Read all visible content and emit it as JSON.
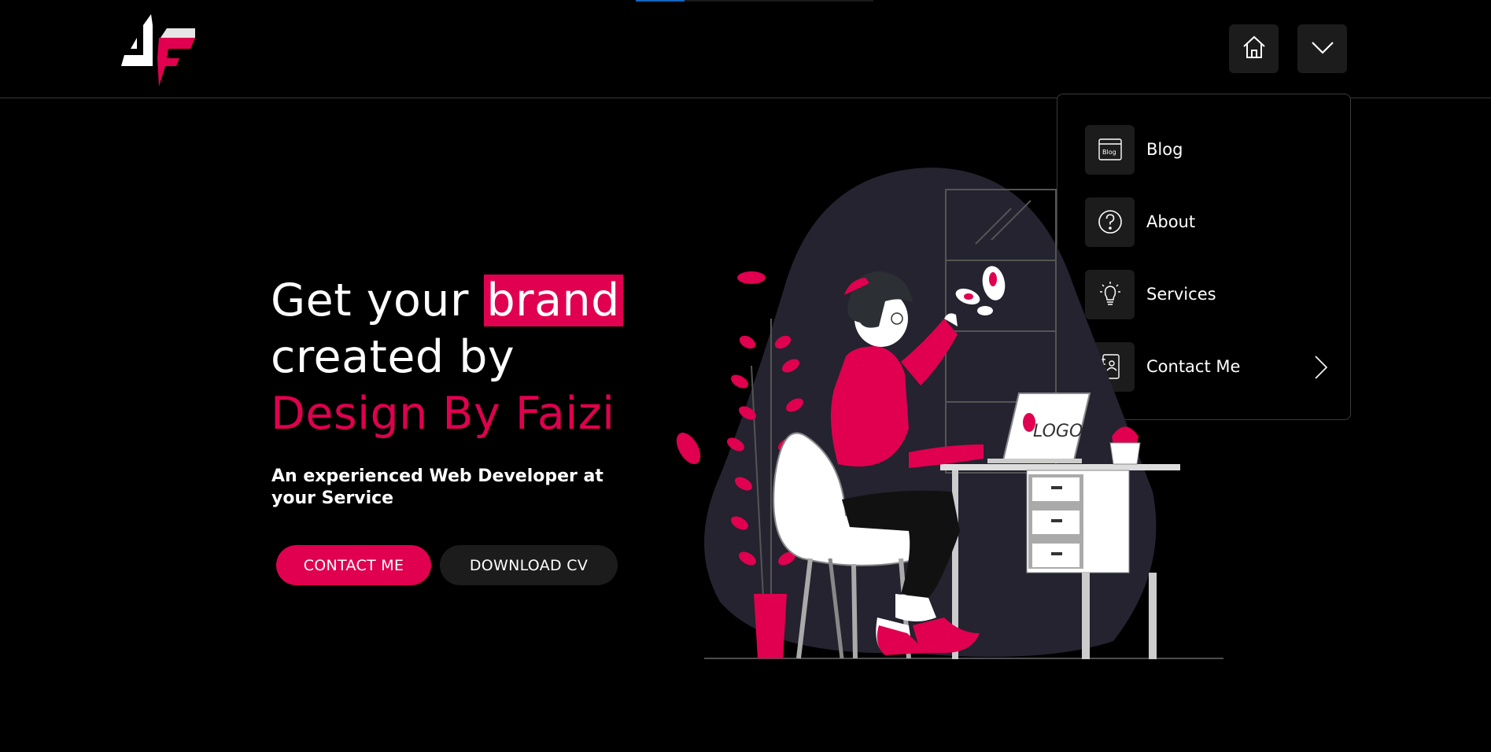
{
  "brand": {
    "logo": "jf-logo-icon"
  },
  "colors": {
    "accent": "#e0004f",
    "background": "#000000",
    "panel": "#1c1c1c",
    "progress": "#1565c0"
  },
  "nav": {
    "home_icon": "home-icon",
    "toggle_icon": "chevron-down-icon",
    "menu": [
      {
        "label": "Blog",
        "icon": "blog-icon"
      },
      {
        "label": "About",
        "icon": "question-icon"
      },
      {
        "label": "Services",
        "icon": "lightbulb-icon"
      },
      {
        "label": "Contact Me",
        "icon": "contact-book-icon",
        "submenu_icon": "chevron-right-icon"
      }
    ]
  },
  "hero": {
    "title_part1": "Get your ",
    "title_highlight": "brand",
    "title_part2": "created by",
    "title_accent": "Design By Faizi",
    "subtitle": "An experienced Web Developer at your Service",
    "primary_button": "CONTACT ME",
    "secondary_button": "DOWNLOAD CV",
    "illustration": {
      "screen_text": "LOGO"
    }
  }
}
